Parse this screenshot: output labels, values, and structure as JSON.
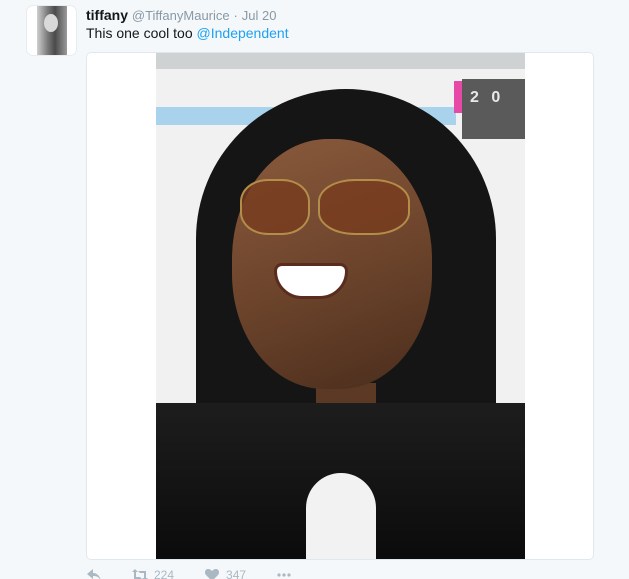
{
  "tweet": {
    "name": "tiffany",
    "handle": "@TiffanyMaurice",
    "separator": "·",
    "date": "Jul 20",
    "text": "This one cool too ",
    "mention": "@Independent"
  },
  "media": {
    "banner_text": "2 0"
  },
  "actions": {
    "reply_icon": "reply-icon",
    "retweet_icon": "retweet-icon",
    "retweet_count": "224",
    "like_icon": "heart-icon",
    "like_count": "347",
    "more_icon": "more-icon"
  }
}
